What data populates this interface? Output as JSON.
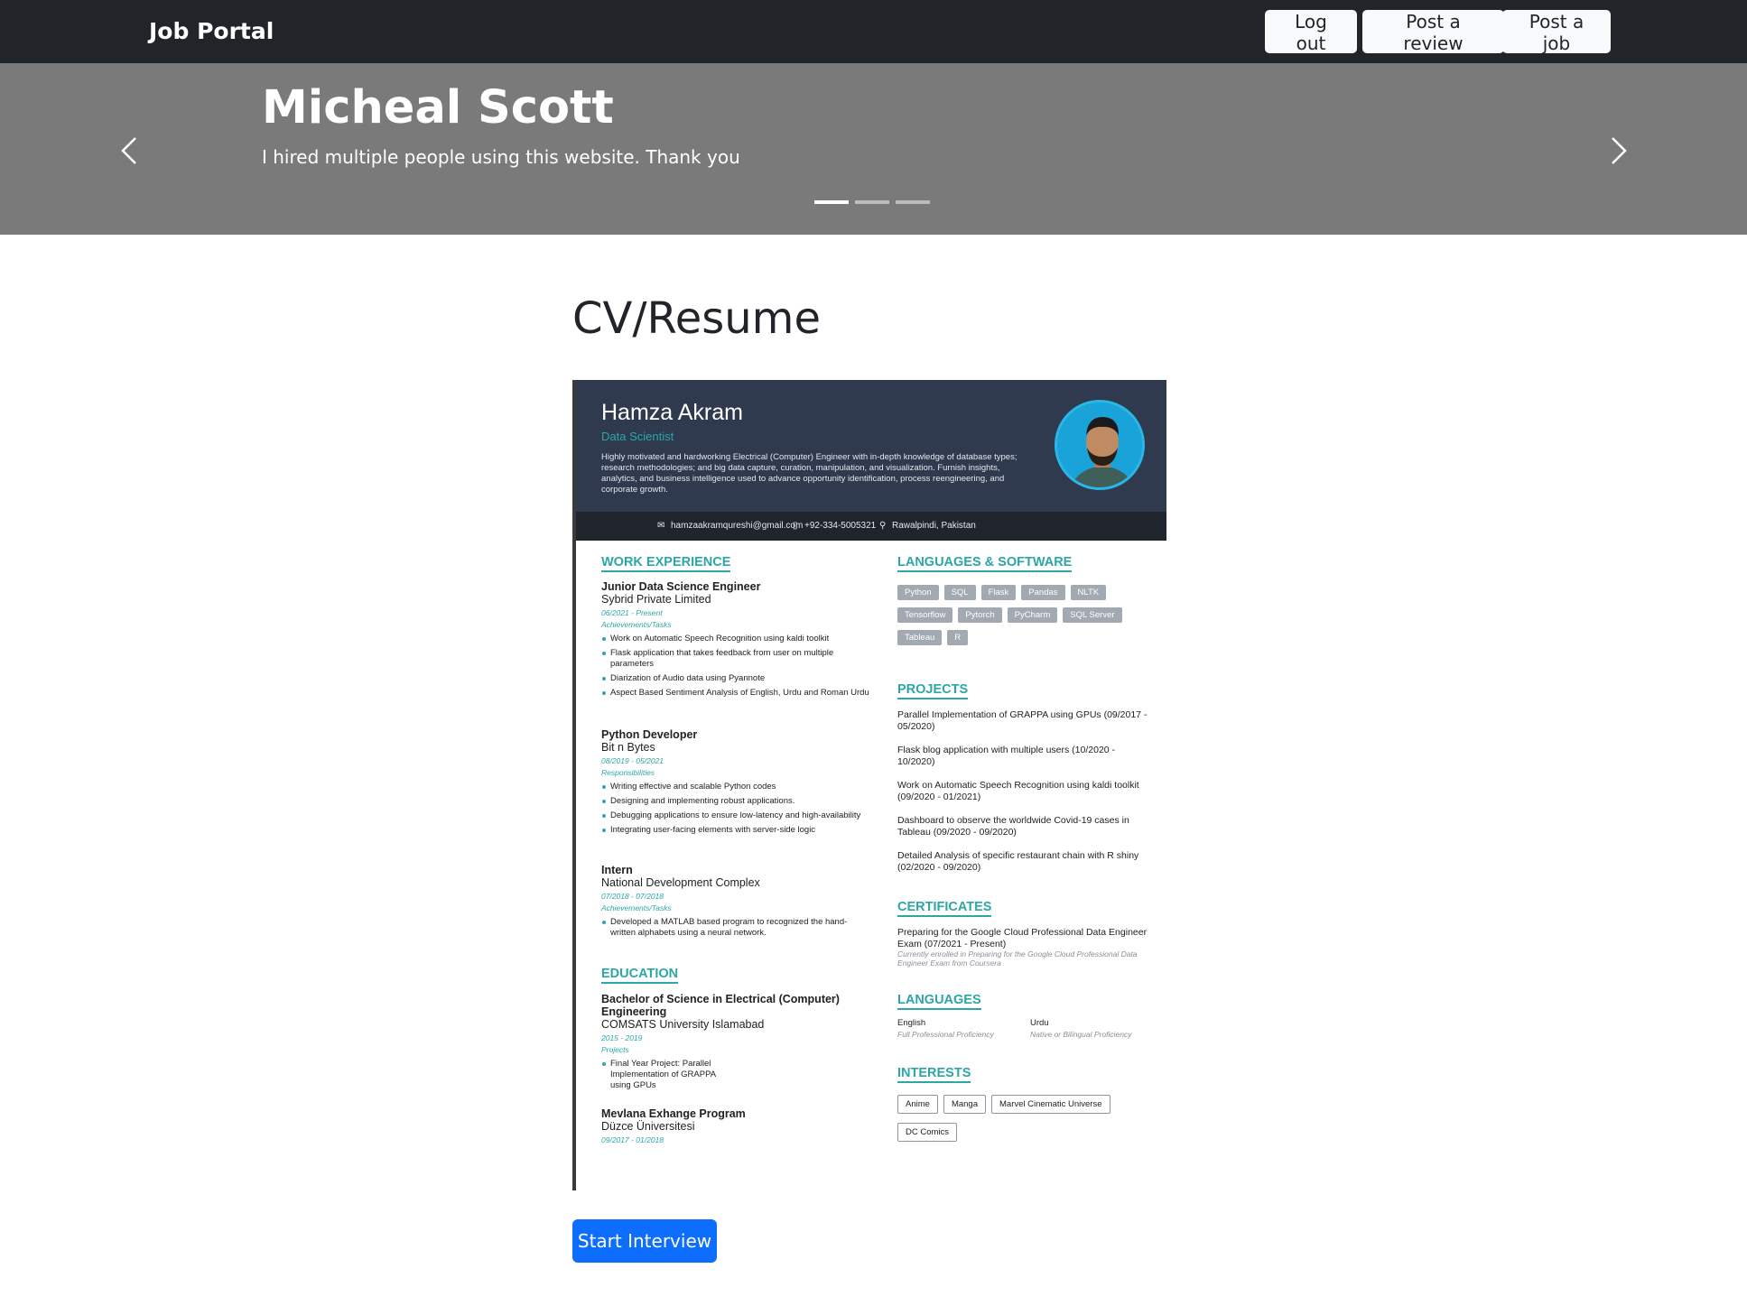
{
  "navbar": {
    "brand": "Job Portal",
    "logout_label": "Log out",
    "review_label": "Post a review",
    "postjob_label": "Post a job"
  },
  "carousel": {
    "name": "Micheal Scott",
    "text": "I hired multiple people using this website. Thank you",
    "active_index": 0,
    "count": 3
  },
  "main": {
    "title": "CV/Resume",
    "start_label": "Start Interview"
  },
  "resume": {
    "name": "Hamza Akram",
    "role": "Data Scientist",
    "summary": "Highly motivated and hardworking Electrical (Computer) Engineer with in-depth knowledge of database types; research methodologies; and big data capture, curation, manipulation, and visualization. Furnish insights, analytics, and business intelligence used to advance opportunity identification, process reengineering, and corporate growth.",
    "email": "hamzaakramqureshi@gmail.com",
    "phone": "+92-334-5005321",
    "location": "Rawalpindi, Pakistan",
    "sections": {
      "work": "WORK EXPERIENCE",
      "education": "EDUCATION",
      "languages_software": "LANGUAGES & SOFTWARE",
      "projects": "PROJECTS",
      "certificates": "CERTIFICATES",
      "languages": "LANGUAGES",
      "interests": "INTERESTS"
    },
    "jobs": [
      {
        "title": "Junior Data Science Engineer",
        "company": "Sybrid Private Limited",
        "dates": "06/2021 - Present",
        "label": "Achievements/Tasks",
        "bullets": [
          "Work on Automatic Speech Recognition using kaldi toolkit",
          "Flask application that takes feedback from user on multiple parameters",
          "Diarization of Audio data using Pyannote",
          "Aspect Based Sentiment Analysis of English, Urdu and Roman Urdu"
        ]
      },
      {
        "title": "Python Developer",
        "company": "Bit n Bytes",
        "dates": "08/2019 - 05/2021",
        "label": "Responsibilities",
        "bullets": [
          "Writing effective and scalable Python codes",
          "Designing and implementing robust applications.",
          "Debugging applications to ensure low-latency and high-availability",
          "Integrating user-facing elements with server-side logic"
        ]
      },
      {
        "title": "Intern",
        "company": "National Development Complex",
        "dates": "07/2018 - 07/2018",
        "label": "Achievements/Tasks",
        "bullets": [
          "Developed a MATLAB based program to recognized the hand-written alphabets using a neural network."
        ]
      }
    ],
    "education": [
      {
        "title": "Bachelor of Science in Electrical (Computer) Engineering",
        "school": "COMSATS University Islamabad",
        "dates": "2015 - 2019",
        "label": "Projects",
        "bullets": [
          "Final Year Project: Parallel Implementation of GRAPPA using GPUs"
        ]
      },
      {
        "title": "Mevlana Exhange Program",
        "school": "Düzce Üniversitesi",
        "dates": "09/2017 - 01/2018"
      }
    ],
    "skills": [
      "Python",
      "SQL",
      "Flask",
      "Pandas",
      "NLTK",
      "Tensorflow",
      "Pytorch",
      "PyCharm",
      "SQL Server",
      "Tableau",
      "R"
    ],
    "projects": [
      "Parallel Implementation of GRAPPA using GPUs (09/2017 - 05/2020)",
      "Flask blog application with multiple users (10/2020 - 10/2020)",
      "Work on Automatic Speech Recognition using kaldi toolkit (09/2020 - 01/2021)",
      "Dashboard to observe the worldwide Covid-19 cases in Tableau (09/2020 - 09/2020)",
      "Detailed Analysis of specific restaurant chain with R shiny (02/2020 - 09/2020)"
    ],
    "certificate": {
      "title": "Preparing for the Google Cloud Professional Data Engineer Exam (07/2021 - Present)",
      "note": "Currently enrolled in Preparing for the Google Cloud Professional Data Engineer Exam from Coursera"
    },
    "languages": [
      {
        "name": "English",
        "level": "Full Professional Proficiency"
      },
      {
        "name": "Urdu",
        "level": "Native or Bilingual Proficiency"
      }
    ],
    "interests": [
      "Anime",
      "Manga",
      "Marvel Cinematic Universe",
      "DC Comics"
    ]
  },
  "colors": {
    "navbar_bg": "#212529",
    "carousel_bg": "#7a7a7a",
    "primary": "#0d6efd",
    "resume_accent": "#2ca6a6",
    "resume_header": "#2f3a4e"
  }
}
